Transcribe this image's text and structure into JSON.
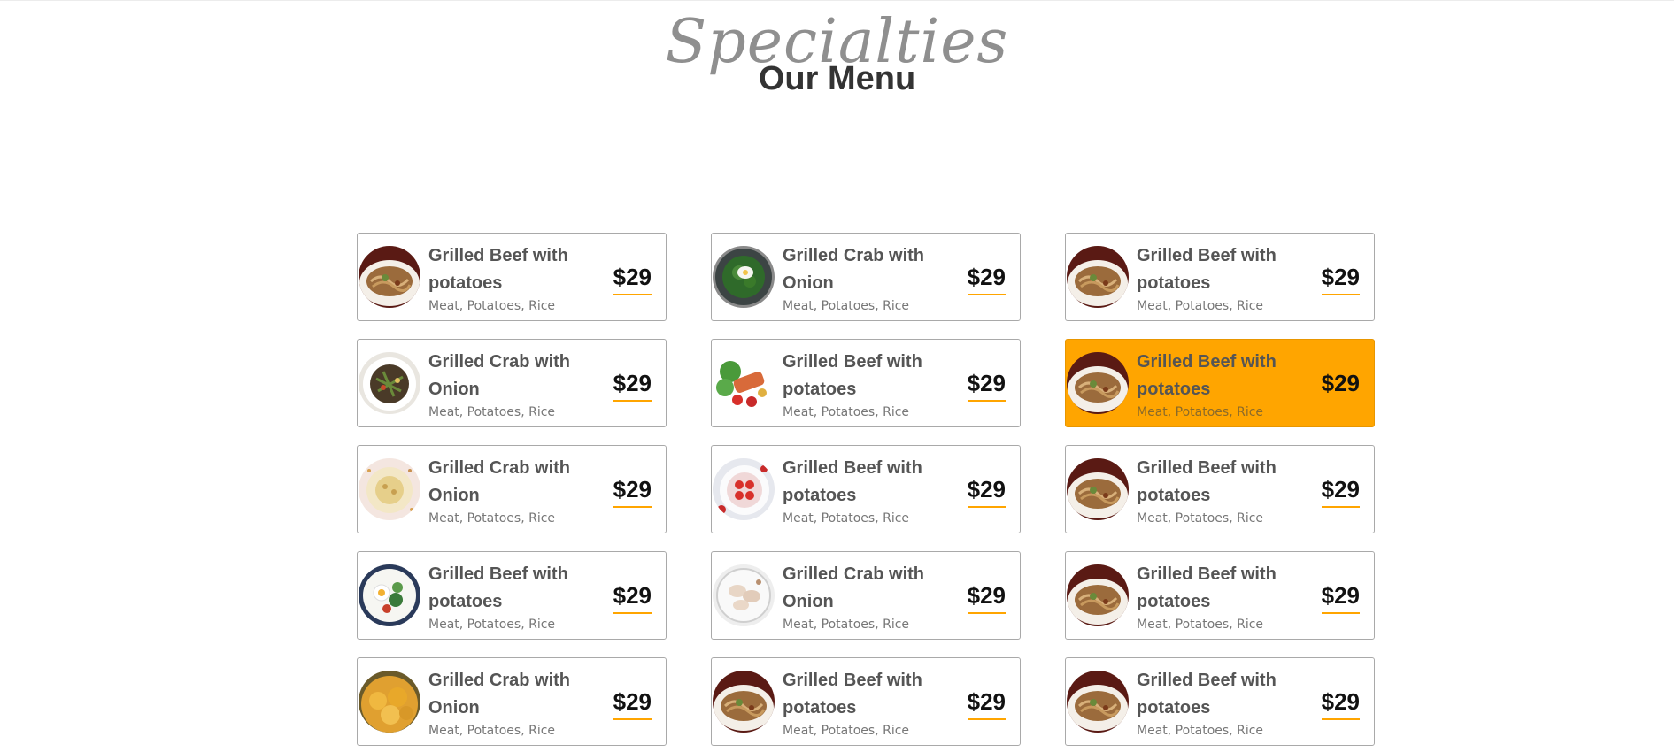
{
  "heading": {
    "script_title": "Specialties",
    "title": "Our Menu"
  },
  "colors": {
    "accent": "#ffa500",
    "card_border": "#a9a9a9",
    "name_text": "#555555",
    "ingredients_text": "#777777"
  },
  "menu": {
    "items": [
      {
        "name": "Grilled Beef with potatoes",
        "ingredients": "Meat, Potatoes, Rice",
        "price": "$29",
        "image": "noodle-plate",
        "highlighted": false
      },
      {
        "name": "Grilled Crab with Onion",
        "ingredients": "Meat, Potatoes, Rice",
        "price": "$29",
        "image": "egg-greens-bowl",
        "highlighted": false
      },
      {
        "name": "Grilled Beef with potatoes",
        "ingredients": "Meat, Potatoes, Rice",
        "price": "$29",
        "image": "noodle-plate",
        "highlighted": false
      },
      {
        "name": "Grilled Crab with Onion",
        "ingredients": "Meat, Potatoes, Rice",
        "price": "$29",
        "image": "mixed-salad-bowl",
        "highlighted": false
      },
      {
        "name": "Grilled Beef with potatoes",
        "ingredients": "Meat, Potatoes, Rice",
        "price": "$29",
        "image": "salmon-salad",
        "highlighted": false
      },
      {
        "name": "Grilled Beef with potatoes",
        "ingredients": "Meat, Potatoes, Rice",
        "price": "$29",
        "image": "noodle-plate",
        "highlighted": true
      },
      {
        "name": "Grilled Crab with Onion",
        "ingredients": "Meat, Potatoes, Rice",
        "price": "$29",
        "image": "cream-bowl",
        "highlighted": false
      },
      {
        "name": "Grilled Beef with potatoes",
        "ingredients": "Meat, Potatoes, Rice",
        "price": "$29",
        "image": "strawberry-plate",
        "highlighted": false
      },
      {
        "name": "Grilled Beef with potatoes",
        "ingredients": "Meat, Potatoes, Rice",
        "price": "$29",
        "image": "noodle-plate",
        "highlighted": false
      },
      {
        "name": "Grilled Beef with potatoes",
        "ingredients": "Meat, Potatoes, Rice",
        "price": "$29",
        "image": "egg-salad-bowl",
        "highlighted": false
      },
      {
        "name": "Grilled Crab with Onion",
        "ingredients": "Meat, Potatoes, Rice",
        "price": "$29",
        "image": "dumpling-plate",
        "highlighted": false
      },
      {
        "name": "Grilled Beef with potatoes",
        "ingredients": "Meat, Potatoes, Rice",
        "price": "$29",
        "image": "noodle-plate",
        "highlighted": false
      },
      {
        "name": "Grilled Crab with Onion",
        "ingredients": "Meat, Potatoes, Rice",
        "price": "$29",
        "image": "fried-chicken",
        "highlighted": false
      },
      {
        "name": "Grilled Beef with potatoes",
        "ingredients": "Meat, Potatoes, Rice",
        "price": "$29",
        "image": "noodle-plate",
        "highlighted": false
      },
      {
        "name": "Grilled Beef with potatoes",
        "ingredients": "Meat, Potatoes, Rice",
        "price": "$29",
        "image": "noodle-plate",
        "highlighted": false
      }
    ]
  }
}
